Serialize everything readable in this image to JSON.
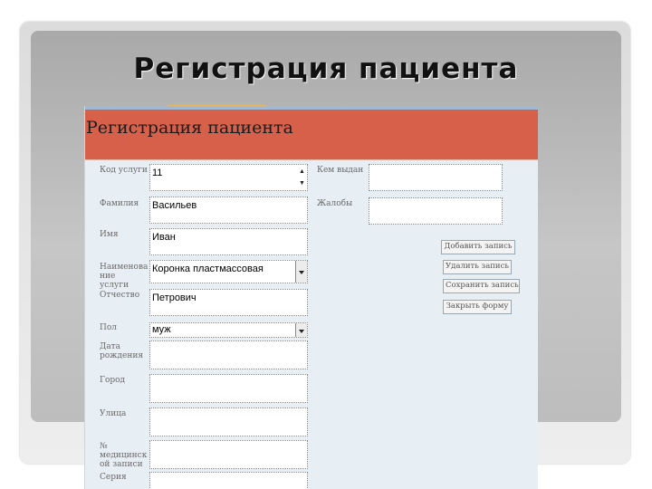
{
  "slide": {
    "title": "Регистрация пациента"
  },
  "form": {
    "title": "Регистрация пациента",
    "fields": [
      {
        "label": "Код услуги",
        "value": "11"
      },
      {
        "label": "Фамилия",
        "value": "Васильев"
      },
      {
        "label": "Имя",
        "value": "Иван"
      },
      {
        "label": "Наименова ние услуги",
        "value": "Коронка пластмассовая"
      },
      {
        "label": "Отчество",
        "value": "Петрович"
      },
      {
        "label": "Пол",
        "value": "муж"
      },
      {
        "label": "Дата рождения",
        "value": ""
      },
      {
        "label": "Город",
        "value": ""
      },
      {
        "label": "Улица",
        "value": ""
      },
      {
        "label": "№ медицинск ой записи",
        "value": ""
      },
      {
        "label": "Серия",
        "value": ""
      }
    ],
    "right_fields": [
      {
        "label": "Кем выдан",
        "value": ""
      },
      {
        "label": "Жалобы",
        "value": ""
      }
    ],
    "buttons": {
      "add": "Добавить запись",
      "delete": "Удалить запись",
      "save": "Сохранить запись",
      "close": "Закрыть форму"
    }
  }
}
